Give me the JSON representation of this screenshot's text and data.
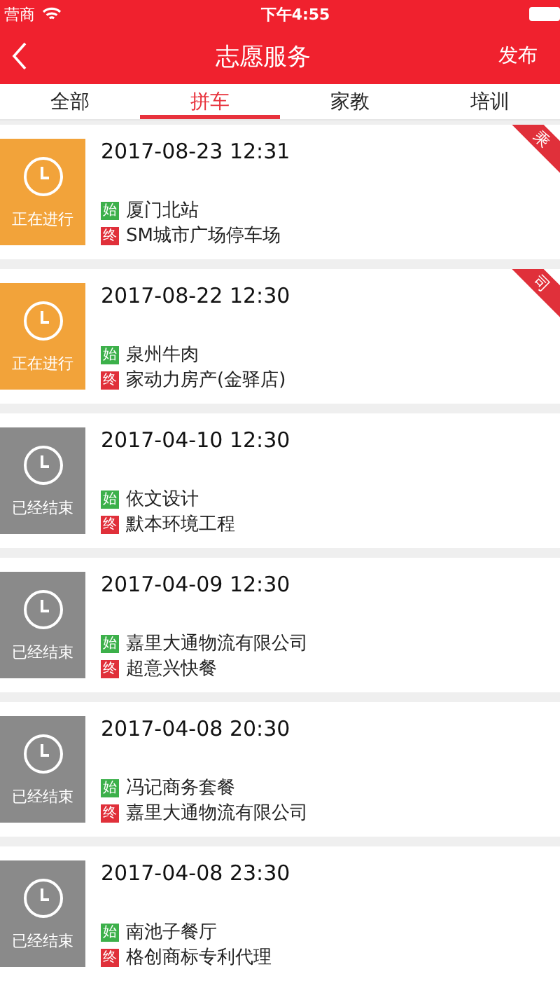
{
  "status_bar": {
    "carrier": "营商",
    "time": "下午4:55"
  },
  "nav": {
    "title": "志愿服务",
    "action": "发布"
  },
  "tabs": [
    {
      "label": "全部",
      "selected": false
    },
    {
      "label": "拼车",
      "selected": true
    },
    {
      "label": "家教",
      "selected": false
    },
    {
      "label": "培训",
      "selected": false
    }
  ],
  "trips": [
    {
      "kind": "ongoing",
      "status_label": "正在进行",
      "datetime": "2017-08-23 12:31",
      "start_mark": "始",
      "start": "厦门北站",
      "end_mark": "终",
      "end": "SM城市广场停车场",
      "ribbon": "乘"
    },
    {
      "kind": "ongoing",
      "status_label": "正在进行",
      "datetime": "2017-08-22 12:30",
      "start_mark": "始",
      "start": "泉州牛肉",
      "end_mark": "终",
      "end": "家动力房产(金驿店)",
      "ribbon": "司"
    },
    {
      "kind": "ended",
      "status_label": "已经结束",
      "datetime": "2017-04-10 12:30",
      "start_mark": "始",
      "start": "依文设计",
      "end_mark": "终",
      "end": "默本环境工程"
    },
    {
      "kind": "ended",
      "status_label": "已经结束",
      "datetime": "2017-04-09 12:30",
      "start_mark": "始",
      "start": "嘉里大通物流有限公司",
      "end_mark": "终",
      "end": "超意兴快餐"
    },
    {
      "kind": "ended",
      "status_label": "已经结束",
      "datetime": "2017-04-08 20:30",
      "start_mark": "始",
      "start": "冯记商务套餐",
      "end_mark": "终",
      "end": "嘉里大通物流有限公司"
    },
    {
      "kind": "ended",
      "status_label": "已经结束",
      "datetime": "2017-04-08 23:30",
      "start_mark": "始",
      "start": "南池子餐厅",
      "end_mark": "终",
      "end": "格创商标专利代理"
    }
  ]
}
